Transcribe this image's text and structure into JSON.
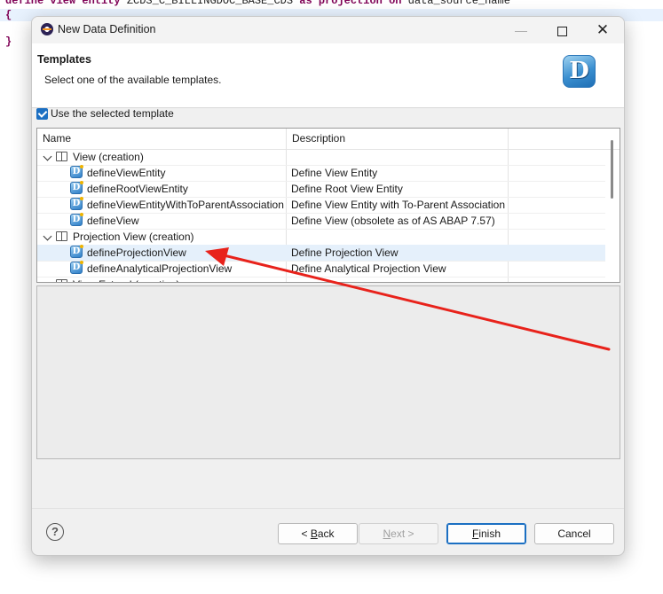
{
  "editor": {
    "line1_kw1": "define view entity",
    "line1_id": "ZCDS_C_BILLINGDOC_BASE_CDS",
    "line1_kw2": "as projection on",
    "line1_src": "data_source_name",
    "line2": "{",
    "line3": "}"
  },
  "dialog": {
    "title": "New Data Definition",
    "header_title": "Templates",
    "header_subtitle": "Select one of the available templates.",
    "logo_letter": "D",
    "use_template_label": "Use the selected template",
    "use_template_checked": true,
    "columns": [
      "Name",
      "Description"
    ],
    "tree": [
      {
        "type": "group",
        "name": "View (creation)",
        "description": ""
      },
      {
        "type": "item",
        "name": "defineViewEntity",
        "description": "Define View Entity"
      },
      {
        "type": "item",
        "name": "defineRootViewEntity",
        "description": "Define Root View Entity"
      },
      {
        "type": "item",
        "name": "defineViewEntityWithToParentAssociation",
        "description": "Define View Entity with To-Parent Association"
      },
      {
        "type": "item",
        "name": "defineView",
        "description": "Define View (obsolete as of AS ABAP 7.57)"
      },
      {
        "type": "group",
        "name": "Projection View (creation)",
        "description": ""
      },
      {
        "type": "item",
        "name": "defineProjectionView",
        "description": "Define Projection View",
        "selected": true
      },
      {
        "type": "item",
        "name": "defineAnalyticalProjectionView",
        "description": "Define Analytical Projection View"
      },
      {
        "type": "group",
        "name": "View Extend (creation)",
        "description": ""
      }
    ],
    "buttons": {
      "help": "?",
      "back_prefix": "< ",
      "back_mnemonic": "B",
      "back_rest": "ack",
      "next_mnemonic": "N",
      "next_rest": "ext >",
      "finish_mnemonic": "F",
      "finish_rest": "inish",
      "cancel": "Cancel"
    }
  },
  "colors": {
    "arrow": "#e8221b",
    "selection": "#e5f0fb",
    "accent": "#1b6fc2"
  }
}
